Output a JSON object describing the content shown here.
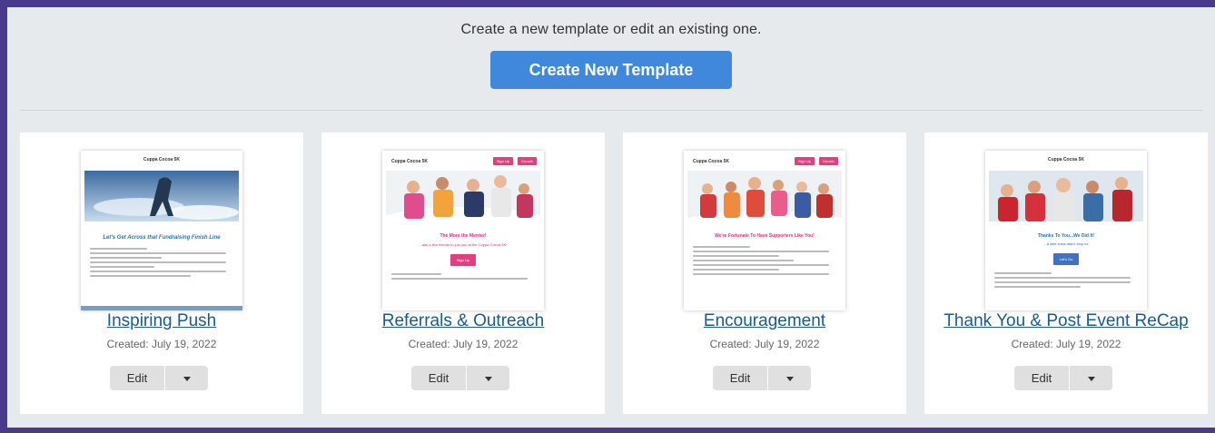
{
  "header": {
    "subtitle": "Create a new template or edit an existing one.",
    "create_label": "Create New Template"
  },
  "colors": {
    "accent": "#3f88db",
    "link": "#1a5b8c",
    "frame": "#4a3a8c",
    "brand_pink": "#e0407f"
  },
  "templates": [
    {
      "title": "Inspiring Push",
      "created": "Created: July 19, 2022",
      "edit_label": "Edit",
      "preview": {
        "brand": "Cuppa Cocoa 5K",
        "headline": "Let's Get Across that Fundraising Finish Line"
      }
    },
    {
      "title": "Referrals & Outreach",
      "created": "Created: July 19, 2022",
      "edit_label": "Edit",
      "preview": {
        "brand": "Cuppa Cocoa 5K",
        "pill1": "Sign Up",
        "pill2": "Donate",
        "headline": "The More the Merrier!",
        "sub": "...ask a few friends to join you at the Cuppa Cocoa 5K!",
        "button": "Sign Up"
      }
    },
    {
      "title": "Encouragement",
      "created": "Created: July 19, 2022",
      "edit_label": "Edit",
      "preview": {
        "brand": "Cuppa Cocoa 5K",
        "pill1": "Sign Up",
        "pill2": "Donate",
        "headline": "We're Fortunate To Have Supporters Like You!"
      }
    },
    {
      "title": "Thank You & Post Event ReCap",
      "created": "Created: July 19, 2022",
      "edit_label": "Edit",
      "preview": {
        "brand": "Cuppa Cocoa 5K",
        "headline": "Thanks To You...We Did It!",
        "sub": "...a little snow didn't stop us",
        "button": "Let's Go"
      }
    }
  ]
}
